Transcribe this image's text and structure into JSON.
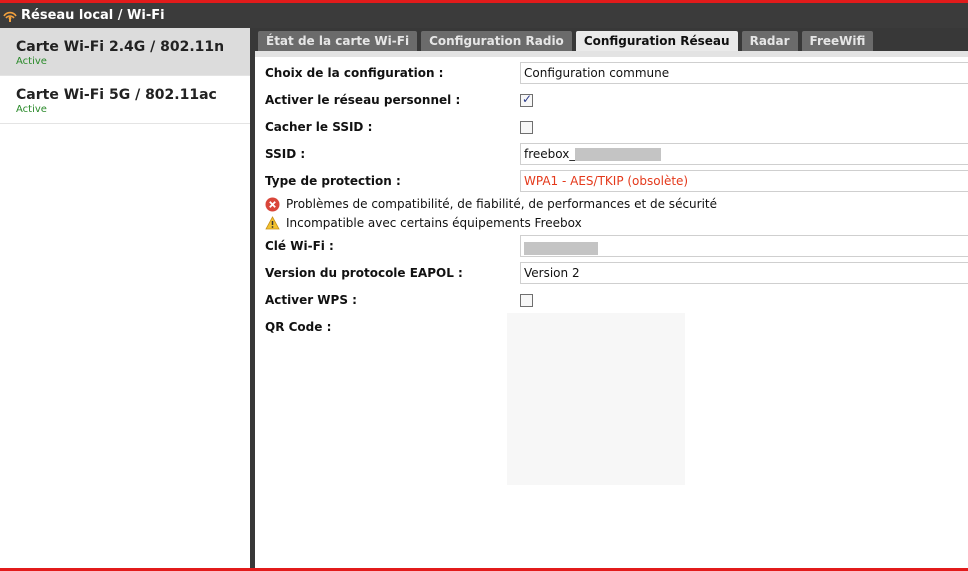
{
  "window": {
    "title": "Réseau local / Wi-Fi",
    "icon": "wifi-icon"
  },
  "sidebar": {
    "items": [
      {
        "label": "Carte Wi-Fi 2.4G / 802.11n",
        "status": "Active",
        "selected": true
      },
      {
        "label": "Carte Wi-Fi 5G / 802.11ac",
        "status": "Active",
        "selected": false
      }
    ]
  },
  "tabs": [
    {
      "label": "État de la carte Wi-Fi",
      "active": false
    },
    {
      "label": "Configuration Radio",
      "active": false
    },
    {
      "label": "Configuration Réseau",
      "active": true
    },
    {
      "label": "Radar",
      "active": false
    },
    {
      "label": "FreeWifi",
      "active": false
    }
  ],
  "form": {
    "config_choice": {
      "label": "Choix de la configuration :",
      "value": "Configuration commune"
    },
    "personal_network": {
      "label": "Activer le réseau personnel :",
      "checked": true
    },
    "hide_ssid": {
      "label": "Cacher le SSID :",
      "checked": false
    },
    "ssid": {
      "label": "SSID :",
      "value": "freebox_"
    },
    "protection": {
      "label": "Type de protection :",
      "value": "WPA1 - AES/TKIP (obsolète)"
    },
    "warnings": [
      {
        "icon": "error-icon",
        "text": "Problèmes de compatibilité, de fiabilité, de performances et de sécurité"
      },
      {
        "icon": "warning-icon",
        "text": "Incompatible avec certains équipements Freebox"
      }
    ],
    "wifi_key": {
      "label": "Clé Wi-Fi :"
    },
    "eapol": {
      "label": "Version du protocole EAPOL :",
      "value": "Version 2"
    },
    "wps": {
      "label": "Activer WPS :",
      "checked": false
    },
    "qr_code": {
      "label": "QR Code :"
    }
  },
  "colors": {
    "accent_red": "#e21b1b",
    "status_green": "#2a8a2a",
    "warning_text": "#e4391b",
    "dark_bar": "#383838"
  }
}
